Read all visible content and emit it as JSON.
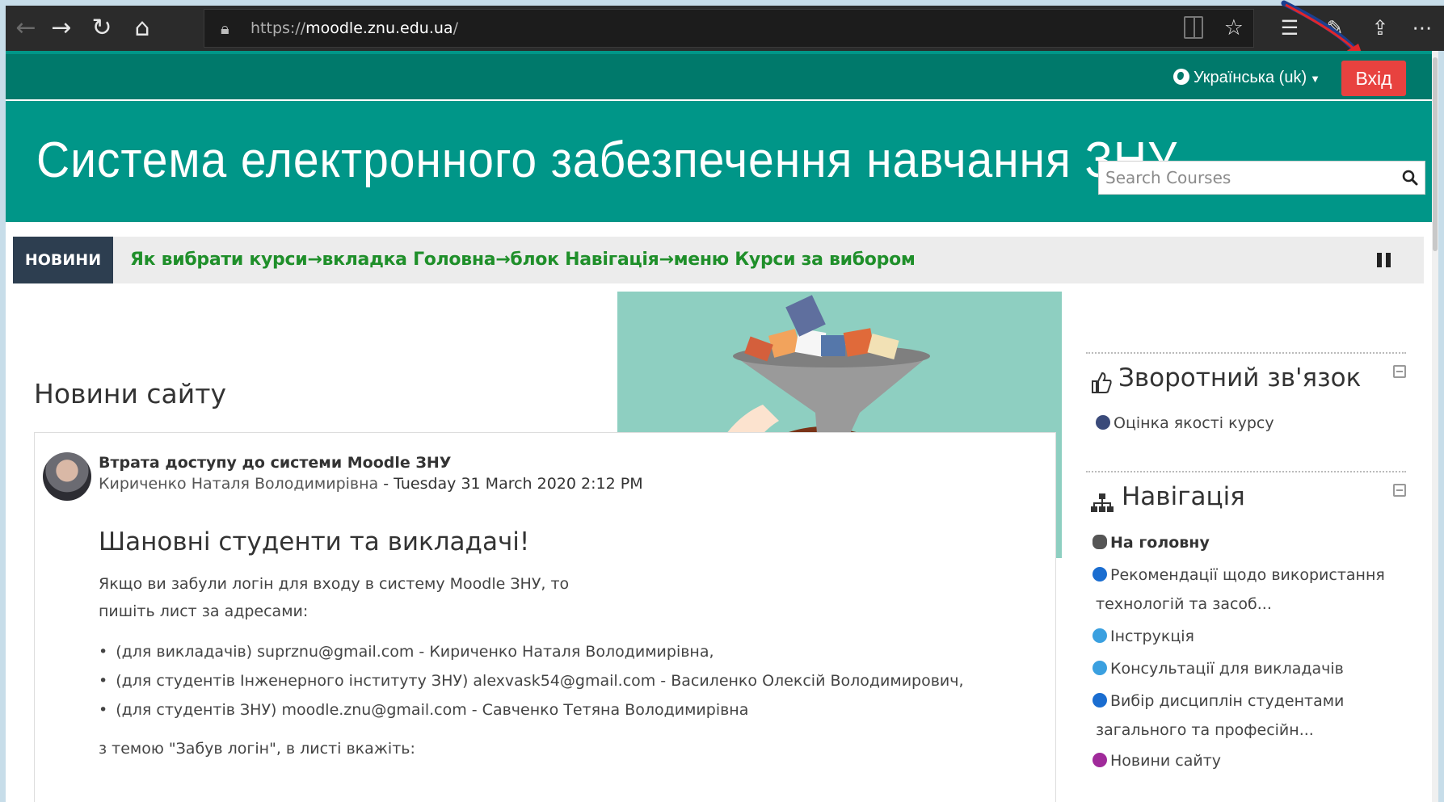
{
  "browser": {
    "url_prefix": "https://",
    "url_domain": "moodle.znu.edu.ua",
    "url_suffix": "/"
  },
  "navbar": {
    "language": "Українська (uk)",
    "login_label": "Вхід"
  },
  "header": {
    "site_title": "Система електронного забезпечення навчання ЗНУ",
    "search_placeholder": "Search Courses"
  },
  "ticker": {
    "label": "НОВИНИ",
    "text": "Як вибрати курси→вкладка Головна→блок Навігація→меню Курси за вибором"
  },
  "news": {
    "heading": "Новини сайту",
    "post": {
      "title": "Втрата доступу до системи Moodle ЗНУ",
      "author": "Кириченко Наталя Володимирівна",
      "date": " - Tuesday 31 March 2020 2:12 PM",
      "greeting": "Шановні студенти та викладачі!",
      "line1": "Якщо  ви забули логін  для входу в систему Moodle ЗНУ, то",
      "line2": "пишіть лист за адресами:",
      "bullets": [
        "(для викладачів) suprznu@gmail.com - Кириченко Наталя Володимирівна,",
        "(для студентів Інженерного інституту ЗНУ) alexvask54@gmail.com  - Василенко Олексій Володимирович,",
        "(для студентів ЗНУ) moodle.znu@gmail.com - Савченко Тетяна Володимирівна"
      ],
      "line3": " з темою \"Забув логін\", в листі вкажіть:"
    }
  },
  "sidebar": {
    "feedback": {
      "title": "Зворотний зв'язок",
      "link": "Оцінка якості курсу"
    },
    "navigation": {
      "title": "Навігація",
      "home": "На головну",
      "items": [
        "Рекомендації щодо використання",
        "технологій та засоб...",
        "Інструкція",
        "Консультації для викладачів",
        "Вибір дисциплін студентами",
        "загального та професійн...",
        "Новини сайту"
      ]
    }
  },
  "colors": {
    "navbar": "#00796b",
    "header": "#009688",
    "login_button": "#e8423f",
    "ticker_label": "#2d3e50",
    "ticker_text": "#1f8f2a"
  }
}
